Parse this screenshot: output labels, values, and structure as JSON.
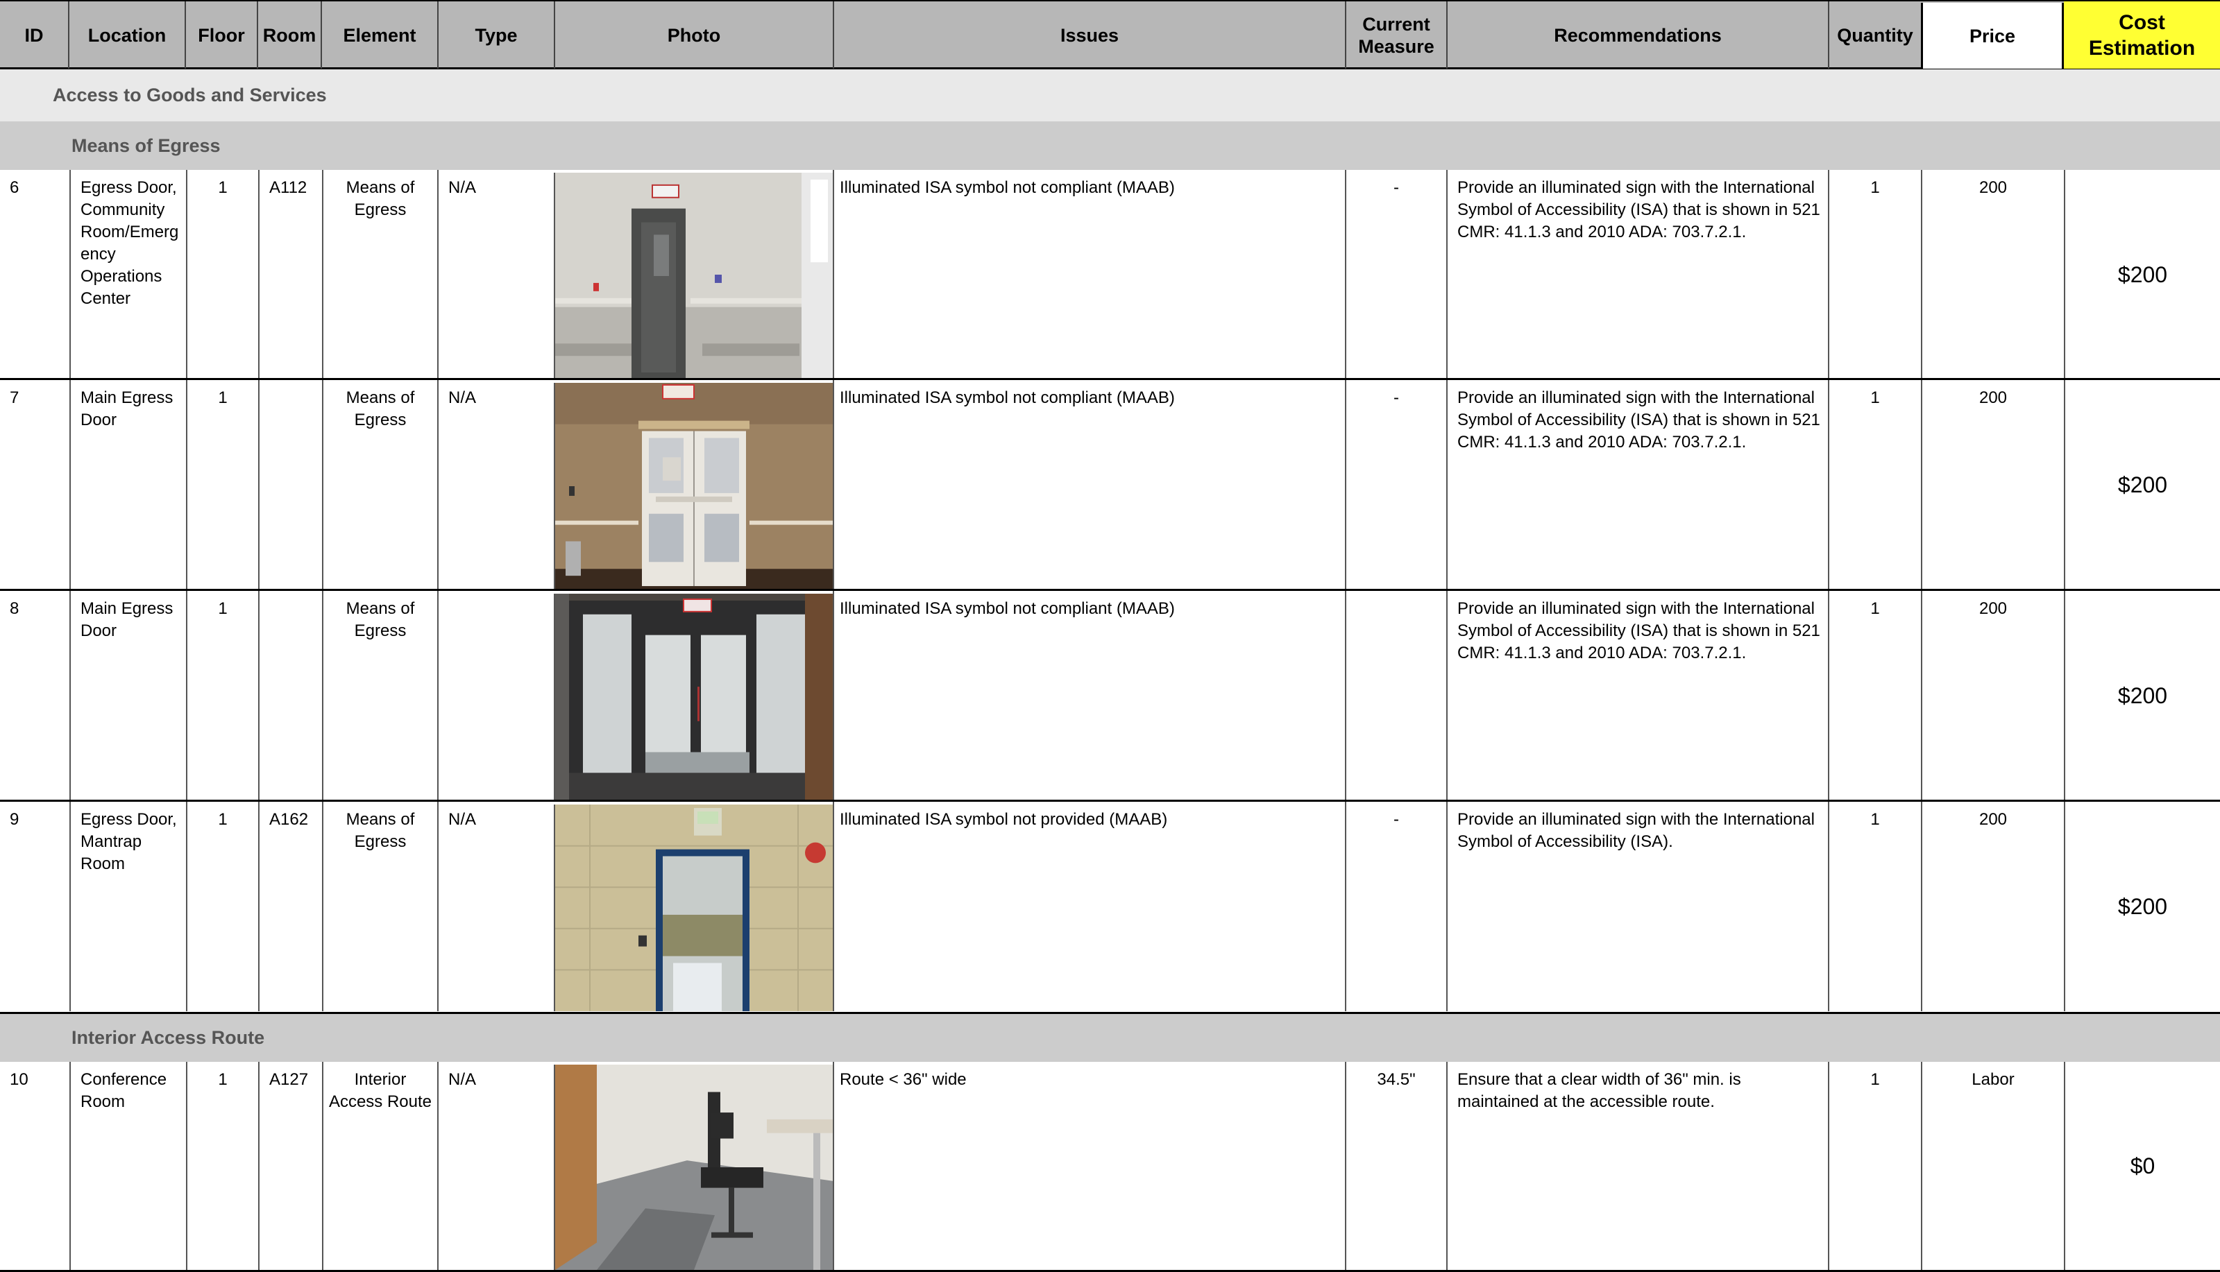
{
  "header": {
    "id": "ID",
    "location": "Location",
    "floor": "Floor",
    "room": "Room",
    "element": "Element",
    "type": "Type",
    "photo": "Photo",
    "issues": "Issues",
    "current_measure": "Current Measure",
    "recommendations": "Recommendations",
    "quantity": "Quantity",
    "price": "Price",
    "cost_estimation": "Cost Estimation"
  },
  "colors": {
    "header_bg": "#b7b7b7",
    "cost_header_bg": "#ffff33",
    "section_light": "#e9e9e9",
    "section_dark": "#cccccc"
  },
  "sections": {
    "category": "Access to Goods and Services",
    "group1": "Means of Egress",
    "group2": "Interior Access Route"
  },
  "rows": [
    {
      "id": "6",
      "location": "Egress Door, Community Room/Emerg ency Operations Center",
      "floor": "1",
      "room": "A112",
      "element": "Means of Egress",
      "type": "N/A",
      "photo": "egress-door-photo",
      "issues": "Illuminated ISA symbol not compliant (MAAB)",
      "current_measure": "-",
      "recommendations": "Provide an illuminated sign with the International Symbol of Accessibility (ISA) that is shown in 521 CMR: 41.1.3 and 2010 ADA: 703.7.2.1.",
      "quantity": "1",
      "price": "200",
      "cost": "$200"
    },
    {
      "id": "7",
      "location": "Main Egress Door",
      "floor": "1",
      "room": "",
      "element": "Means of Egress",
      "type": "N/A",
      "photo": "double-door-photo",
      "issues": "Illuminated ISA symbol not compliant (MAAB)",
      "current_measure": "-",
      "recommendations": "Provide an illuminated sign with the International Symbol of Accessibility (ISA) that is shown in 521 CMR: 41.1.3 and 2010 ADA: 703.7.2.1.",
      "quantity": "1",
      "price": "200",
      "cost": "$200"
    },
    {
      "id": "8",
      "location": "Main Egress Door",
      "floor": "1",
      "room": "",
      "element": "Means of Egress",
      "type": "",
      "photo": "vestibule-doors-photo",
      "issues": "Illuminated ISA symbol not compliant (MAAB)",
      "current_measure": "",
      "recommendations": "Provide an illuminated sign with the International Symbol of Accessibility (ISA) that is shown in 521 CMR: 41.1.3 and 2010 ADA: 703.7.2.1.",
      "quantity": "1",
      "price": "200",
      "cost": "$200"
    },
    {
      "id": "9",
      "location": "Egress Door, Mantrap Room",
      "floor": "1",
      "room": "A162",
      "element": "Means of Egress",
      "type": "N/A",
      "photo": "mantrap-door-photo",
      "issues": "Illuminated ISA symbol not provided (MAAB)",
      "current_measure": "-",
      "recommendations": "Provide an illuminated sign with the International Symbol of Accessibility (ISA).",
      "quantity": "1",
      "price": "200",
      "cost": "$200"
    },
    {
      "id": "10",
      "location": "Conference Room",
      "floor": "1",
      "room": "A127",
      "element": "Interior Access Route",
      "type": "N/A",
      "photo": "conference-room-photo",
      "issues": "Route < 36\" wide",
      "current_measure": "34.5\"",
      "recommendations": "Ensure that a clear width of 36\" min. is maintained at the accessible route.",
      "quantity": "1",
      "price": "Labor",
      "cost": "$0"
    }
  ]
}
